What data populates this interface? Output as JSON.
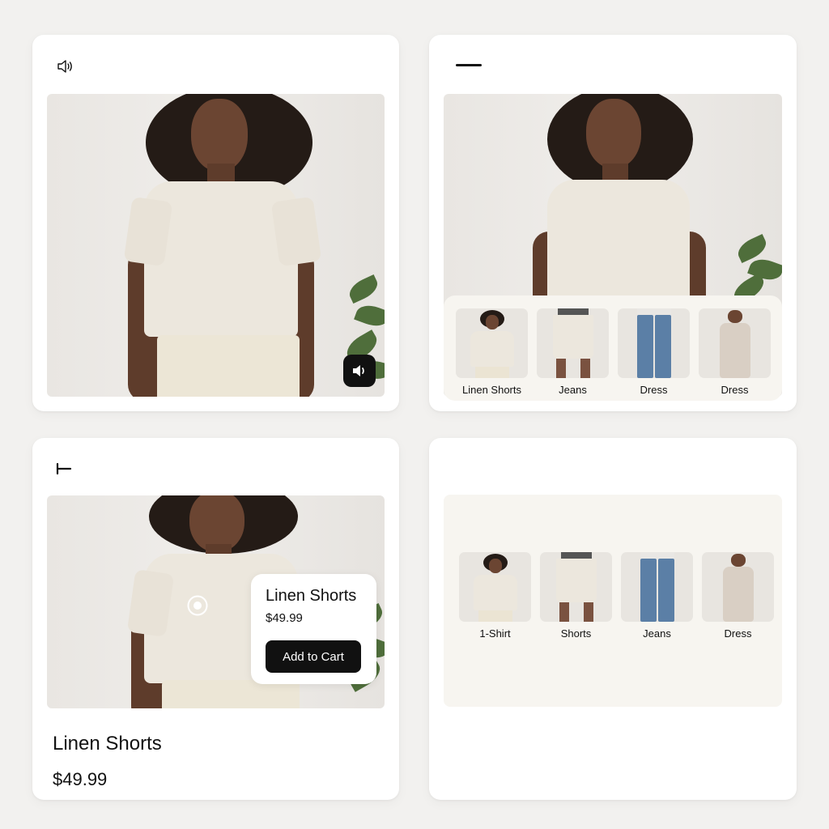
{
  "card1": {
    "top_icon": "speaker-outline-icon",
    "overlay_icon": "speaker-filled-icon"
  },
  "card2": {
    "top_icon": "menu-dash-icon",
    "thumbnails": [
      {
        "label": "Linen Shorts",
        "icon": "model-tee-image"
      },
      {
        "label": "Jeans",
        "icon": "shorts-image"
      },
      {
        "label": "Dress",
        "icon": "jeans-image"
      },
      {
        "label": "Dress",
        "icon": "dress-image"
      }
    ]
  },
  "card3": {
    "top_icon": "text-tool-icon",
    "hotspot_icon": "target-hotspot-icon",
    "popup": {
      "title": "Linen Shorts",
      "price": "$49.99",
      "button": "Add to Cart"
    },
    "product_title": "Linen Shorts",
    "product_price": "$49.99"
  },
  "card4": {
    "thumbnails": [
      {
        "label": "1-Shirt",
        "icon": "model-tee-image"
      },
      {
        "label": "Shorts",
        "icon": "shorts-image"
      },
      {
        "label": "Jeans",
        "icon": "jeans-image"
      },
      {
        "label": "Dress",
        "icon": "dress-image"
      }
    ]
  },
  "colors": {
    "background": "#f2f1ef",
    "card": "#ffffff",
    "button": "#111111",
    "strip": "#f7f5f0"
  }
}
